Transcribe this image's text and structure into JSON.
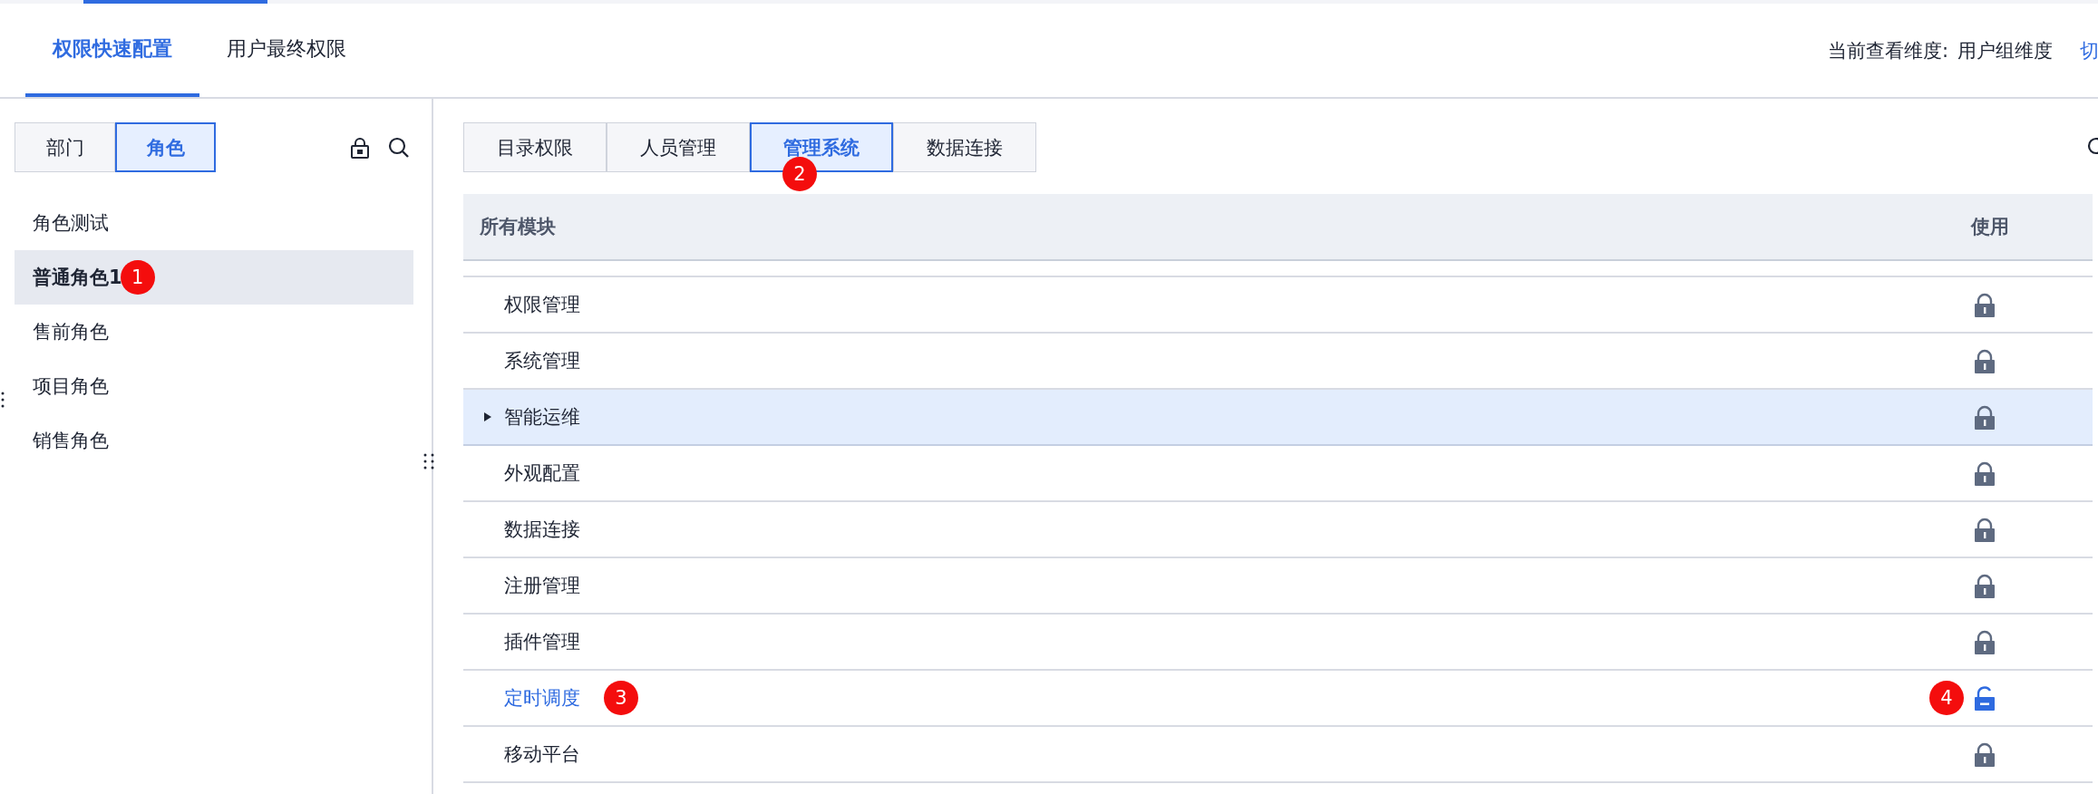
{
  "top_tabs": [
    {
      "label": "权限快速配置",
      "selected": true
    },
    {
      "label": "用户最终权限",
      "selected": false
    }
  ],
  "view_dimension": {
    "label": "当前查看维度:",
    "value": "用户组维度",
    "switch_link": "切"
  },
  "left_panel": {
    "segments": [
      {
        "label": "部门",
        "selected": false
      },
      {
        "label": "角色",
        "selected": true
      }
    ],
    "roles": [
      {
        "name": "角色测试",
        "selected": false
      },
      {
        "name": "普通角色1",
        "selected": true,
        "badge": "1"
      },
      {
        "name": "售前角色",
        "selected": false
      },
      {
        "name": "项目角色",
        "selected": false
      },
      {
        "name": "销售角色",
        "selected": false
      }
    ]
  },
  "module_tabs": [
    {
      "label": "目录权限",
      "selected": false
    },
    {
      "label": "人员管理",
      "selected": false
    },
    {
      "label": "管理系统",
      "selected": true,
      "badge": "2"
    },
    {
      "label": "数据连接",
      "selected": false
    }
  ],
  "table": {
    "columns": [
      "所有模块",
      "使用"
    ],
    "rows": [
      {
        "name": "权限管理",
        "locked": true,
        "expandable": false,
        "selected": false
      },
      {
        "name": "系统管理",
        "locked": true,
        "expandable": false,
        "selected": false
      },
      {
        "name": "智能运维",
        "locked": true,
        "expandable": true,
        "selected": true
      },
      {
        "name": "外观配置",
        "locked": true,
        "expandable": false,
        "selected": false
      },
      {
        "name": "数据连接",
        "locked": true,
        "expandable": false,
        "selected": false
      },
      {
        "name": "注册管理",
        "locked": true,
        "expandable": false,
        "selected": false
      },
      {
        "name": "插件管理",
        "locked": true,
        "expandable": false,
        "selected": false
      },
      {
        "name": "定时调度",
        "locked": false,
        "expandable": false,
        "selected": false,
        "badge": "3",
        "lock_badge": "4"
      },
      {
        "name": "移动平台",
        "locked": true,
        "expandable": false,
        "selected": false
      }
    ]
  }
}
